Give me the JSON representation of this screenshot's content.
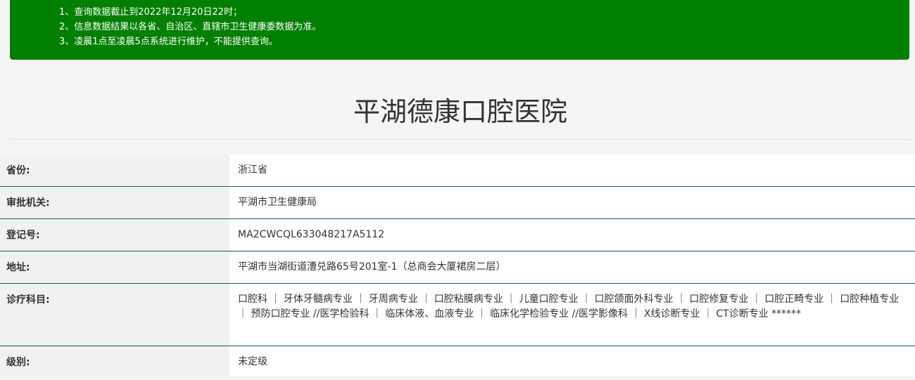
{
  "notice": {
    "lines": [
      "1、查询数据截止到2022年12月20日22时；",
      "2、信息数据结果以各省、自治区、直辖市卫生健康委数据为准。",
      "3、凌晨1点至凌晨5点系统进行维护，不能提供查询。"
    ],
    "bg_color": "#007f00"
  },
  "title": "平湖德康口腔医院",
  "rows": [
    {
      "label": "省份:",
      "value": "浙江省"
    },
    {
      "label": "审批机关:",
      "value": "平湖市卫生健康局"
    },
    {
      "label": "登记号:",
      "value": "MA2CWCQL633048217A5112"
    },
    {
      "label": "地址:",
      "value": "平湖市当湖街道漕兑路65号201室-1（总商会大厦裙房二层）"
    },
    {
      "label": "诊疗科目:",
      "value": "口腔科 ｜ 牙体牙髓病专业 ｜ 牙周病专业 ｜ 口腔粘膜病专业 ｜ 儿童口腔专业 ｜ 口腔颌面外科专业 ｜ 口腔修复专业 ｜ 口腔正畸专业 ｜ 口腔种植专业 ｜ 预防口腔专业 //医学检验科 ｜ 临床体液、血液专业 ｜ 临床化学检验专业 //医学影像科 ｜ X线诊断专业 ｜ CT诊断专业 ******"
    },
    {
      "label": "级别:",
      "value": "未定级"
    }
  ]
}
